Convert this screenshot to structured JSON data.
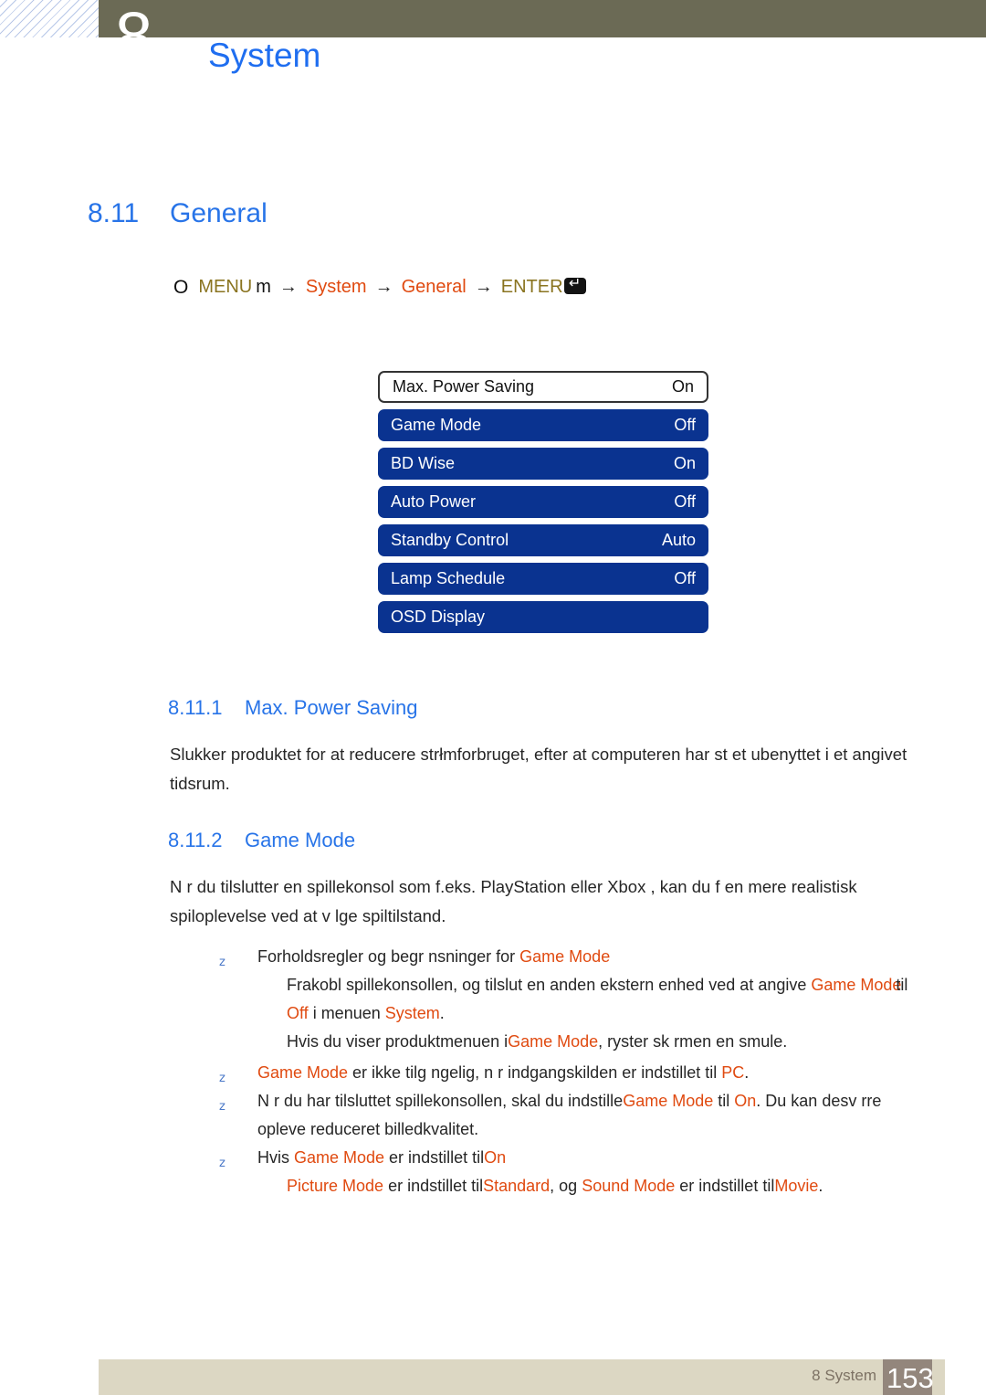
{
  "header": {
    "chapter_number": "8",
    "title": "System"
  },
  "section": {
    "number": "8.11",
    "title": "General"
  },
  "menu_path": {
    "bullet": "O",
    "menu_label": "MENU",
    "menu_glyph": "m",
    "arrow": "→",
    "step_system": "System",
    "step_general": "General",
    "enter_label": "ENTER",
    "enter_glyph": "enter-key-icon"
  },
  "osd_menu": {
    "items": [
      {
        "label": "Max. Power Saving",
        "value": "On",
        "selected": true
      },
      {
        "label": "Game Mode",
        "value": "Off",
        "selected": false
      },
      {
        "label": "BD Wise",
        "value": "On",
        "selected": false
      },
      {
        "label": "Auto Power",
        "value": "Off",
        "selected": false
      },
      {
        "label": "Standby Control",
        "value": "Auto",
        "selected": false
      },
      {
        "label": "Lamp Schedule",
        "value": "Off",
        "selected": false
      },
      {
        "label": "OSD Display",
        "value": "",
        "selected": false
      }
    ]
  },
  "subsection_1": {
    "number": "8.11.1",
    "title": "Max. Power Saving",
    "paragraph": "Slukker produktet for at reducere strłmforbruget, efter at computeren har st et ubenyttet i et angivet tidsrum."
  },
  "subsection_2": {
    "number": "8.11.2",
    "title": "Game Mode",
    "paragraph": "N r du tilslutter en spillekonsol som f.eks. PlayStation  eller Xbox , kan du f  en mere realistisk spiloplevelse ved at v lge spiltilstand.",
    "bullets": {
      "b1_text_a": "Forholdsregler og begr nsninger for ",
      "b1_term": "Game Mode",
      "b1_sub1_a": "Frakobl spillekonsollen, og tilslut en anden ekstern enhed ved at angive ",
      "b1_sub1_term1": "Game Mode",
      "b1_sub1_b": "til ",
      "b1_sub1_term2": "Off",
      "b1_sub1_c": " i menuen ",
      "b1_sub1_term3": "System",
      "b1_sub1_d": ".",
      "b1_sub2_a": "Hvis du viser produktmenuen i",
      "b1_sub2_term": "Game Mode",
      "b1_sub2_b": ", ryster sk rmen en smule.",
      "b2_term": "Game Mode",
      "b2_a": " er ikke tilg ngelig, n r indgangskilden er indstillet til ",
      "b2_term2": "PC",
      "b2_b": ".",
      "b3_a": "N r du har tilsluttet spillekonsollen, skal du indstille",
      "b3_term": "Game Mode",
      "b3_b": " til ",
      "b3_term2": "On",
      "b3_c": ". Du kan desv rre opleve reduceret billedkvalitet.",
      "b4_a": "Hvis ",
      "b4_term": "Game Mode",
      "b4_b": " er indstillet til",
      "b4_term2": "On",
      "b4_sub_term1": "Picture Mode",
      "b4_sub_a": " er indstillet til",
      "b4_sub_term2": "Standard",
      "b4_sub_b": ", og ",
      "b4_sub_term3": "Sound Mode",
      "b4_sub_c": " er indstillet til",
      "b4_sub_term4": "Movie",
      "b4_sub_d": "."
    }
  },
  "footer": {
    "label": "8 System",
    "page_number": "153"
  },
  "colors": {
    "header_bar": "#6b6a55",
    "heading_blue": "#2874e8",
    "osd_blue": "#0a3390",
    "term_orange": "#e04a10",
    "menu_gold": "#8a7420",
    "footer_bar": "#dcd7c3",
    "footer_page_box": "#93867c"
  }
}
